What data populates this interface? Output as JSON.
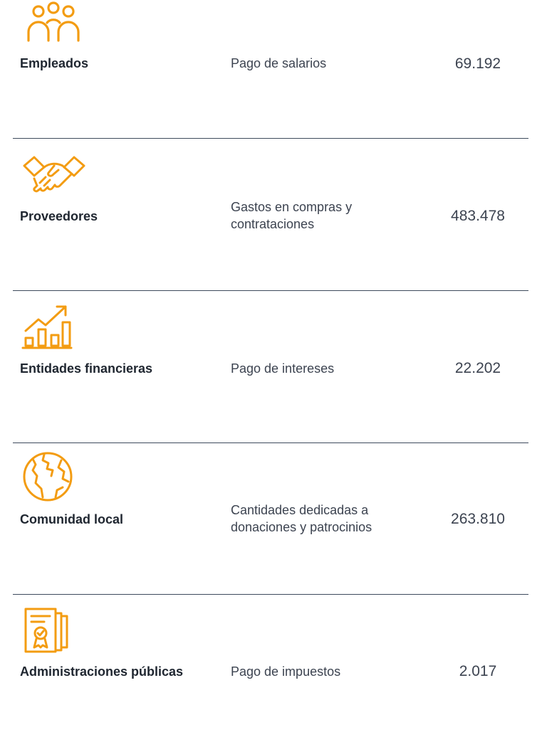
{
  "colors": {
    "accent": "#f39c12",
    "divider": "#3d4a5c"
  },
  "rows": [
    {
      "icon": "people-icon",
      "group": "Empleados",
      "description": "Pago de salarios",
      "value": "69.192"
    },
    {
      "icon": "handshake-icon",
      "group": "Proveedores",
      "description": "Gastos en compras y contrataciones",
      "value": "483.478"
    },
    {
      "icon": "growth-chart-icon",
      "group": "Entidades financieras",
      "description": "Pago de intereses",
      "value": "22.202"
    },
    {
      "icon": "globe-icon",
      "group": "Comunidad local",
      "description": "Cantidades dedicadas a donaciones y patrocinios",
      "value": "263.810"
    },
    {
      "icon": "certificate-document-icon",
      "group": "Administraciones públicas",
      "description": "Pago de impuestos",
      "value": "2.017"
    }
  ]
}
